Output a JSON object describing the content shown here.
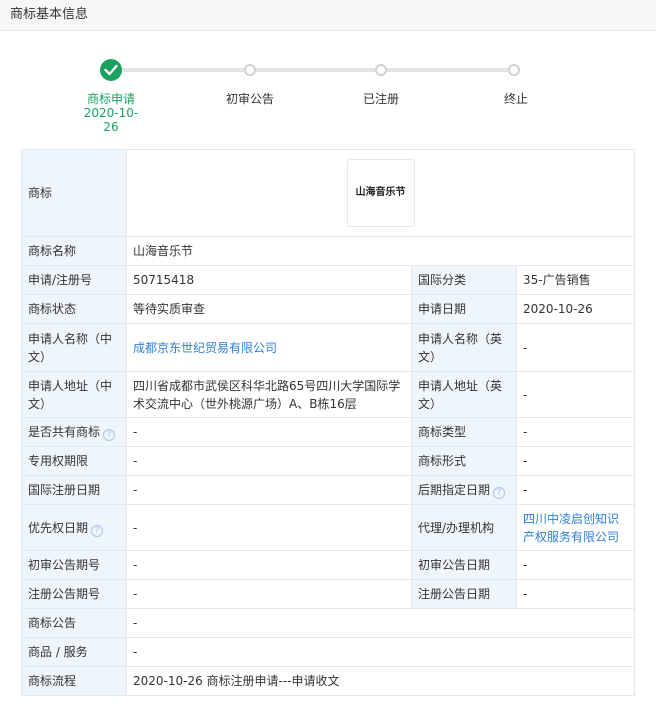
{
  "header": {
    "title": "商标基本信息"
  },
  "steps": [
    {
      "label": "商标申请",
      "date": "2020-10-",
      "date2": "26",
      "status": "done"
    },
    {
      "label": "初审公告",
      "status": "pending"
    },
    {
      "label": "已注册",
      "status": "pending"
    },
    {
      "label": "终止",
      "status": "pending"
    }
  ],
  "table": {
    "trademark": {
      "label": "商标",
      "image_text": "山海音乐节"
    },
    "name": {
      "label": "商标名称",
      "value": "山海音乐节"
    },
    "reg_no": {
      "label": "申请/注册号",
      "value": "50715418"
    },
    "intl_class": {
      "label": "国际分类",
      "value": "35-广告销售"
    },
    "status": {
      "label": "商标状态",
      "value": "等待实质审查"
    },
    "apply_date": {
      "label": "申请日期",
      "value": "2020-10-26"
    },
    "applicant_cn": {
      "label": "申请人名称（中文）",
      "value": "成都京东世纪贸易有限公司"
    },
    "applicant_en": {
      "label": "申请人名称（英文）",
      "value": "-"
    },
    "address_cn": {
      "label": "申请人地址（中文）",
      "value": "四川省成都市武侯区科华北路65号四川大学国际学术交流中心（世外桃源广场）A、B栋16层"
    },
    "address_en": {
      "label": "申请人地址（英文）",
      "value": "-"
    },
    "shared": {
      "label": "是否共有商标",
      "value": "-"
    },
    "tm_type": {
      "label": "商标类型",
      "value": "-"
    },
    "exclusive_period": {
      "label": "专用权期限",
      "value": "-"
    },
    "tm_form": {
      "label": "商标形式",
      "value": "-"
    },
    "intl_reg_date": {
      "label": "国际注册日期",
      "value": "-"
    },
    "later_designation": {
      "label": "后期指定日期",
      "value": "-"
    },
    "priority_date": {
      "label": "优先权日期",
      "value": "-"
    },
    "agent": {
      "label": "代理/办理机构",
      "value": "四川中凌启创知识产权服务有限公司"
    },
    "prelim_issue": {
      "label": "初审公告期号",
      "value": "-"
    },
    "prelim_date": {
      "label": "初审公告日期",
      "value": "-"
    },
    "reg_issue": {
      "label": "注册公告期号",
      "value": "-"
    },
    "reg_date": {
      "label": "注册公告日期",
      "value": "-"
    },
    "announcement": {
      "label": "商标公告",
      "value": "-"
    },
    "goods": {
      "label": "商品 / 服务",
      "value": "-"
    },
    "process": {
      "label": "商标流程",
      "value": "2020-10-26 商标注册申请---申请收文"
    }
  },
  "colors": {
    "accent_green": "#19a15f",
    "link_blue": "#2f7fd8",
    "label_bg": "#eef5fb"
  }
}
